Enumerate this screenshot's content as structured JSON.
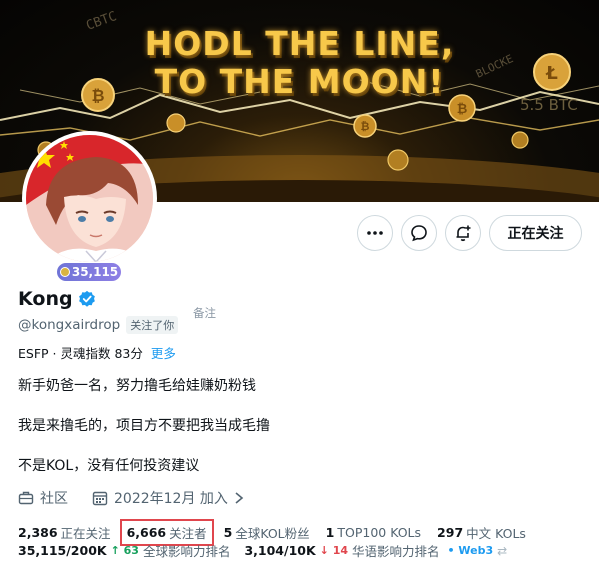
{
  "banner": {
    "line1": "HODL THE LINE,",
    "line2": "TO THE MOON!",
    "bg_words": [
      "CBTC",
      "BLOCKE",
      "5.5 BTC"
    ]
  },
  "profile": {
    "score_badge": "35,115",
    "name": "Kong",
    "handle": "@kongxairdrop",
    "follows_you": "关注了你",
    "note_label": "备注",
    "mbti": "ESFP · 灵魂指数 83分",
    "more": "更多",
    "bio": [
      "新手奶爸一名，努力撸毛给娃赚奶粉钱",
      "我是来撸毛的，项目方不要把我当成毛撸",
      "不是KOL，没有任何投资建议"
    ],
    "community": "社区",
    "joined": "2022年12月 加入"
  },
  "buttons": {
    "more": "more",
    "message": "message",
    "notify": "notify",
    "following": "正在关注"
  },
  "stats": {
    "following_count": "2,386",
    "following_label": "正在关注",
    "followers_count": "6,666",
    "followers_label": "关注者",
    "kol_fans_count": "5",
    "kol_fans_label": "全球KOL粉丝",
    "top100_count": "1",
    "top100_label": "TOP100 KOLs",
    "cn_kol_count": "297",
    "cn_kol_label": "中文 KOLs"
  },
  "ranks": {
    "global_value": "35,115/200K",
    "global_change": "↑ 63",
    "global_label": "全球影响力排名",
    "cn_value": "3,104/10K",
    "cn_change": "↓ 14",
    "cn_label": "华语影响力排名",
    "tag": "• Web3",
    "swap": "⇄"
  },
  "colors": {
    "accent_blue": "#1d9bf0",
    "highlight_red": "#e0464d",
    "up_green": "#17a05d",
    "banner_gold": "#f7c84a"
  }
}
